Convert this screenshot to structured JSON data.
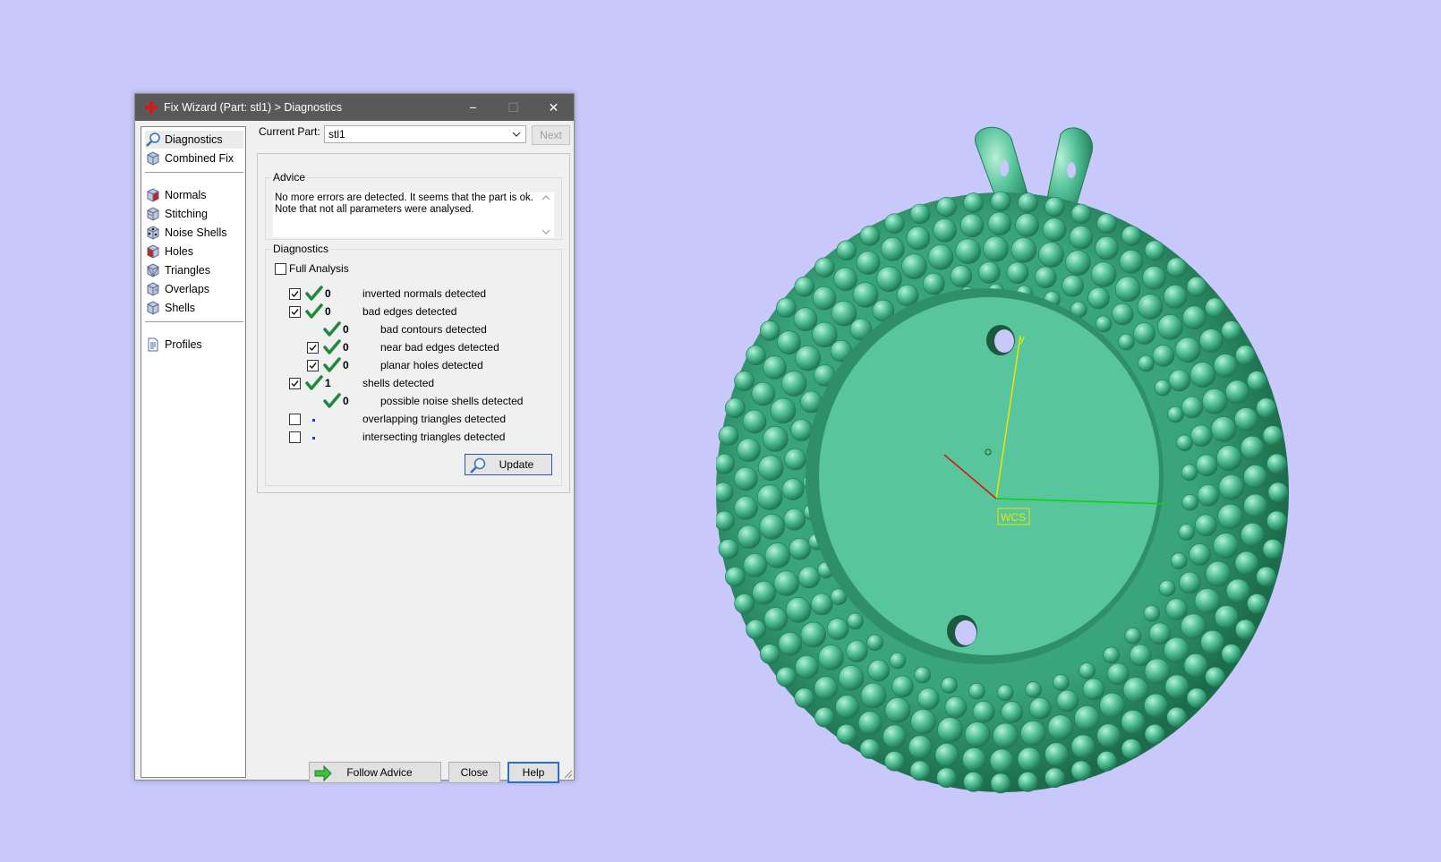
{
  "window": {
    "title": "Fix Wizard (Part: stl1) > Diagnostics",
    "minimize": "−",
    "maximize": "☐",
    "close": "✕"
  },
  "nav": {
    "items": [
      {
        "label": "Diagnostics",
        "icon": "magnifier-icon"
      },
      {
        "label": "Combined Fix",
        "icon": "cube-icon"
      },
      {
        "label": "Normals",
        "icon": "normals-cube-icon"
      },
      {
        "label": "Stitching",
        "icon": "stitching-cube-icon"
      },
      {
        "label": "Noise Shells",
        "icon": "noise-shells-cube-icon"
      },
      {
        "label": "Holes",
        "icon": "holes-cube-icon"
      },
      {
        "label": "Triangles",
        "icon": "triangles-cube-icon"
      },
      {
        "label": "Overlaps",
        "icon": "overlaps-cube-icon"
      },
      {
        "label": "Shells",
        "icon": "shells-cube-icon"
      },
      {
        "label": "Profiles",
        "icon": "document-icon"
      }
    ]
  },
  "header": {
    "current_part_label": "Current Part:",
    "current_part_value": "stl1",
    "next_label": "Next"
  },
  "advice": {
    "title": "Advice",
    "line1": "No more errors are detected. It seems that the part is ok.",
    "line2": "Note that not all parameters were analysed."
  },
  "diagnostics": {
    "title": "Diagnostics",
    "full_analysis_label": "Full Analysis",
    "full_analysis_checked": false,
    "rows": [
      {
        "checked": true,
        "count": "0",
        "label": "inverted normals detected"
      },
      {
        "checked": true,
        "count": "0",
        "label": "bad edges detected"
      },
      {
        "checked": null,
        "count": "0",
        "label": "bad contours detected"
      },
      {
        "checked": true,
        "count": "0",
        "label": "near bad edges detected"
      },
      {
        "checked": true,
        "count": "0",
        "label": "planar holes detected"
      },
      {
        "checked": true,
        "count": "1",
        "label": "shells detected"
      },
      {
        "checked": null,
        "count": "0",
        "label": "possible noise shells detected"
      },
      {
        "checked": false,
        "count": "",
        "label": "overlapping triangles detected"
      },
      {
        "checked": false,
        "count": "",
        "label": "intersecting triangles detected"
      }
    ],
    "update_label": "Update"
  },
  "footer": {
    "follow_advice_label": "Follow Advice",
    "close_label": "Close",
    "help_label": "Help"
  },
  "viewport": {
    "wcs_label": "WCS",
    "axis_y_label": "y",
    "colors": {
      "background": "#c8c8fa",
      "part": "#58c59c",
      "x_axis": "#e01010",
      "y_axis": "#e8e800",
      "z_axis": "#10d010"
    }
  }
}
